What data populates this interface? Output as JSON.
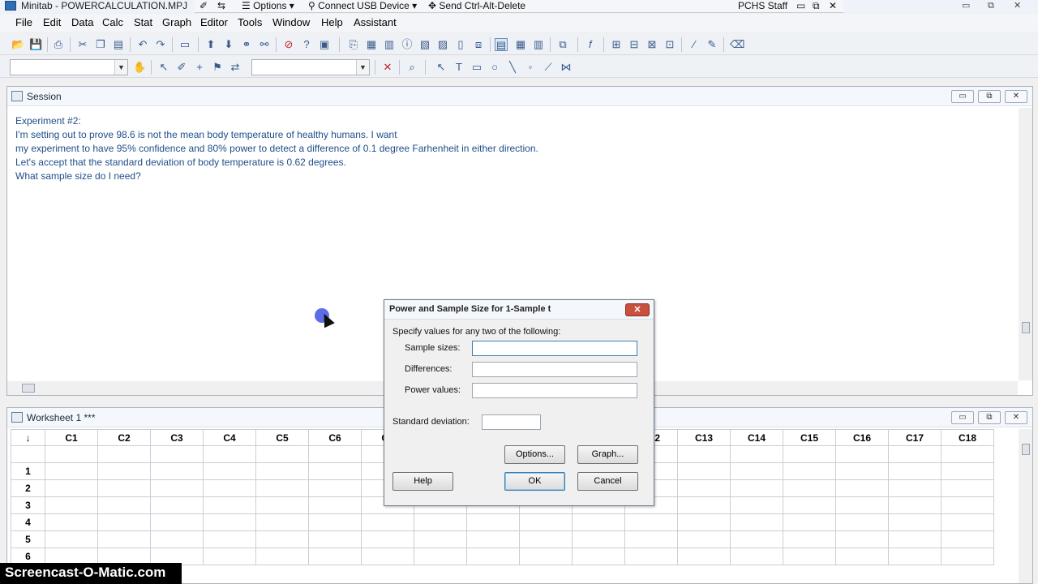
{
  "titlebar": {
    "app_title": "Minitab - POWERCALCULATION.MPJ",
    "options": "Options",
    "connect_usb": "Connect USB Device",
    "send_cad": "Send Ctrl-Alt-Delete",
    "user": "PCHS Staff"
  },
  "menu": {
    "items": [
      "File",
      "Edit",
      "Data",
      "Calc",
      "Stat",
      "Graph",
      "Editor",
      "Tools",
      "Window",
      "Help",
      "Assistant"
    ]
  },
  "session": {
    "title": "Session",
    "lines": [
      "Experiment #2:",
      "I'm setting out to prove 98.6 is not the mean body temperature of healthy humans. I want",
      "my experiment to have 95% confidence and  80% power to detect a difference of 0.1 degree Farhenheit in either direction.",
      "Let's accept that the standard deviation of body temperature is 0.62 degrees.",
      "What sample size do I need?"
    ]
  },
  "worksheet": {
    "title": "Worksheet 1 ***",
    "columns": [
      "C1",
      "C2",
      "C3",
      "C4",
      "C5",
      "C6",
      "C7",
      "",
      "",
      "",
      "",
      "C12",
      "C13",
      "C14",
      "C15",
      "C16",
      "C17",
      "C18"
    ],
    "rows": [
      "1",
      "2",
      "3",
      "4",
      "5",
      "6"
    ]
  },
  "dialog": {
    "title": "Power and Sample Size for 1-Sample t",
    "instruction": "Specify values for any two of the following:",
    "sample_sizes_label": "Sample sizes:",
    "sample_sizes_value": "",
    "differences_label": "Differences:",
    "differences_value": "",
    "power_values_label": "Power values:",
    "power_values_value": "",
    "std_dev_label": "Standard deviation:",
    "std_dev_value": "",
    "options_btn": "Options...",
    "graph_btn": "Graph...",
    "help_btn": "Help",
    "ok_btn": "OK",
    "cancel_btn": "Cancel"
  },
  "watermark": "Screencast-O-Matic.com"
}
